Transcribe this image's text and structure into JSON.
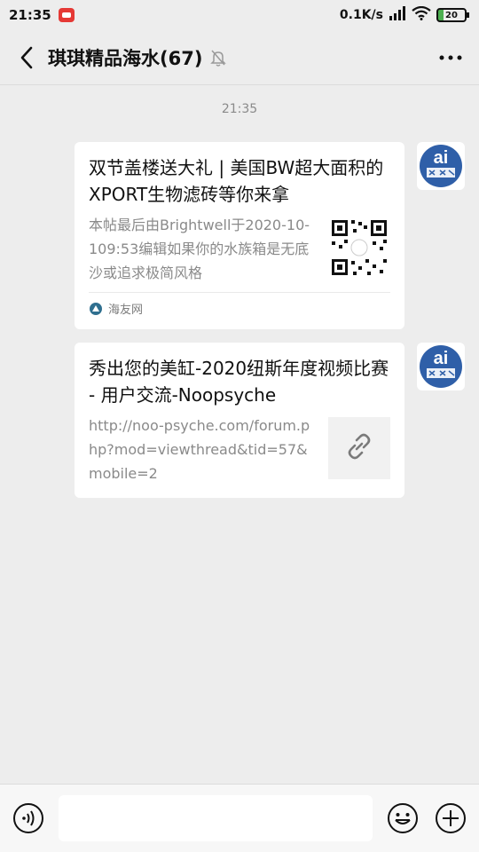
{
  "status_bar": {
    "time": "21:35",
    "network_speed": "0.1K/s",
    "battery": "20"
  },
  "header": {
    "title": "琪琪精品海水(67)"
  },
  "chat": {
    "timestamp": "21:35",
    "messages": [
      {
        "title": "双节盖楼送大礼 | 美国BW超大面积的XPORT生物滤砖等你来拿",
        "description": "本帖最后由Brightwell于2020-10-109:53编辑如果你的水族箱是无底沙或追求极简风格",
        "thumbnail": "qr-code",
        "source": "海友网"
      },
      {
        "title": "秀出您的美缸-2020纽斯年度视频比赛 - 用户交流-Noopsyche",
        "description": "http://noo-psyche.com/forum.php?mod=viewthread&tid=57&mobile=2",
        "thumbnail": "link-icon"
      }
    ]
  },
  "input": {
    "placeholder": ""
  }
}
